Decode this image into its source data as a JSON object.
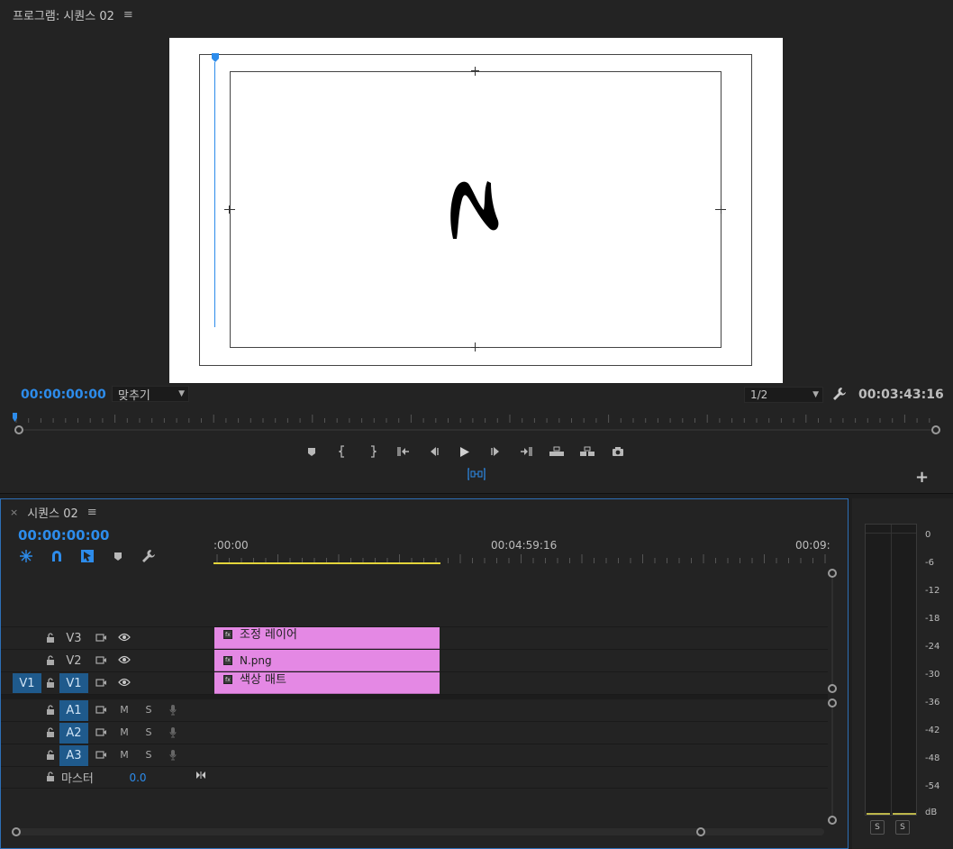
{
  "program": {
    "title": "프로그램: 시퀀스 02",
    "current_timecode": "00:00:00:00",
    "fit_select": "맞추기",
    "resolution_select": "1/2",
    "duration_timecode": "00:03:43:16"
  },
  "timeline": {
    "title": "시퀀스 02",
    "timecode": "00:00:00:00",
    "ruler_labels": [
      ":00:00",
      "00:04:59:16",
      "00:09:"
    ],
    "video_tracks": [
      {
        "source": "",
        "target": "V3",
        "clip": "조정 레이어"
      },
      {
        "source": "",
        "target": "V2",
        "clip": "N.png"
      },
      {
        "source": "V1",
        "target": "V1",
        "clip": "색상 매트"
      }
    ],
    "audio_tracks": [
      {
        "target": "A1",
        "mute": "M",
        "solo": "S"
      },
      {
        "target": "A2",
        "mute": "M",
        "solo": "S"
      },
      {
        "target": "A3",
        "mute": "M",
        "solo": "S"
      }
    ],
    "master": {
      "label": "마스터",
      "value": "0.0"
    }
  },
  "meter": {
    "db_labels": [
      "0",
      "-6",
      "-12",
      "-18",
      "-24",
      "-30",
      "-36",
      "-42",
      "-48",
      "-54",
      "dB"
    ],
    "solo_left": "S",
    "solo_right": "S"
  },
  "colors": {
    "accent_blue": "#2d8ceb",
    "clip_pink": "#e488e4",
    "work_area_yellow": "#e3d53b"
  }
}
